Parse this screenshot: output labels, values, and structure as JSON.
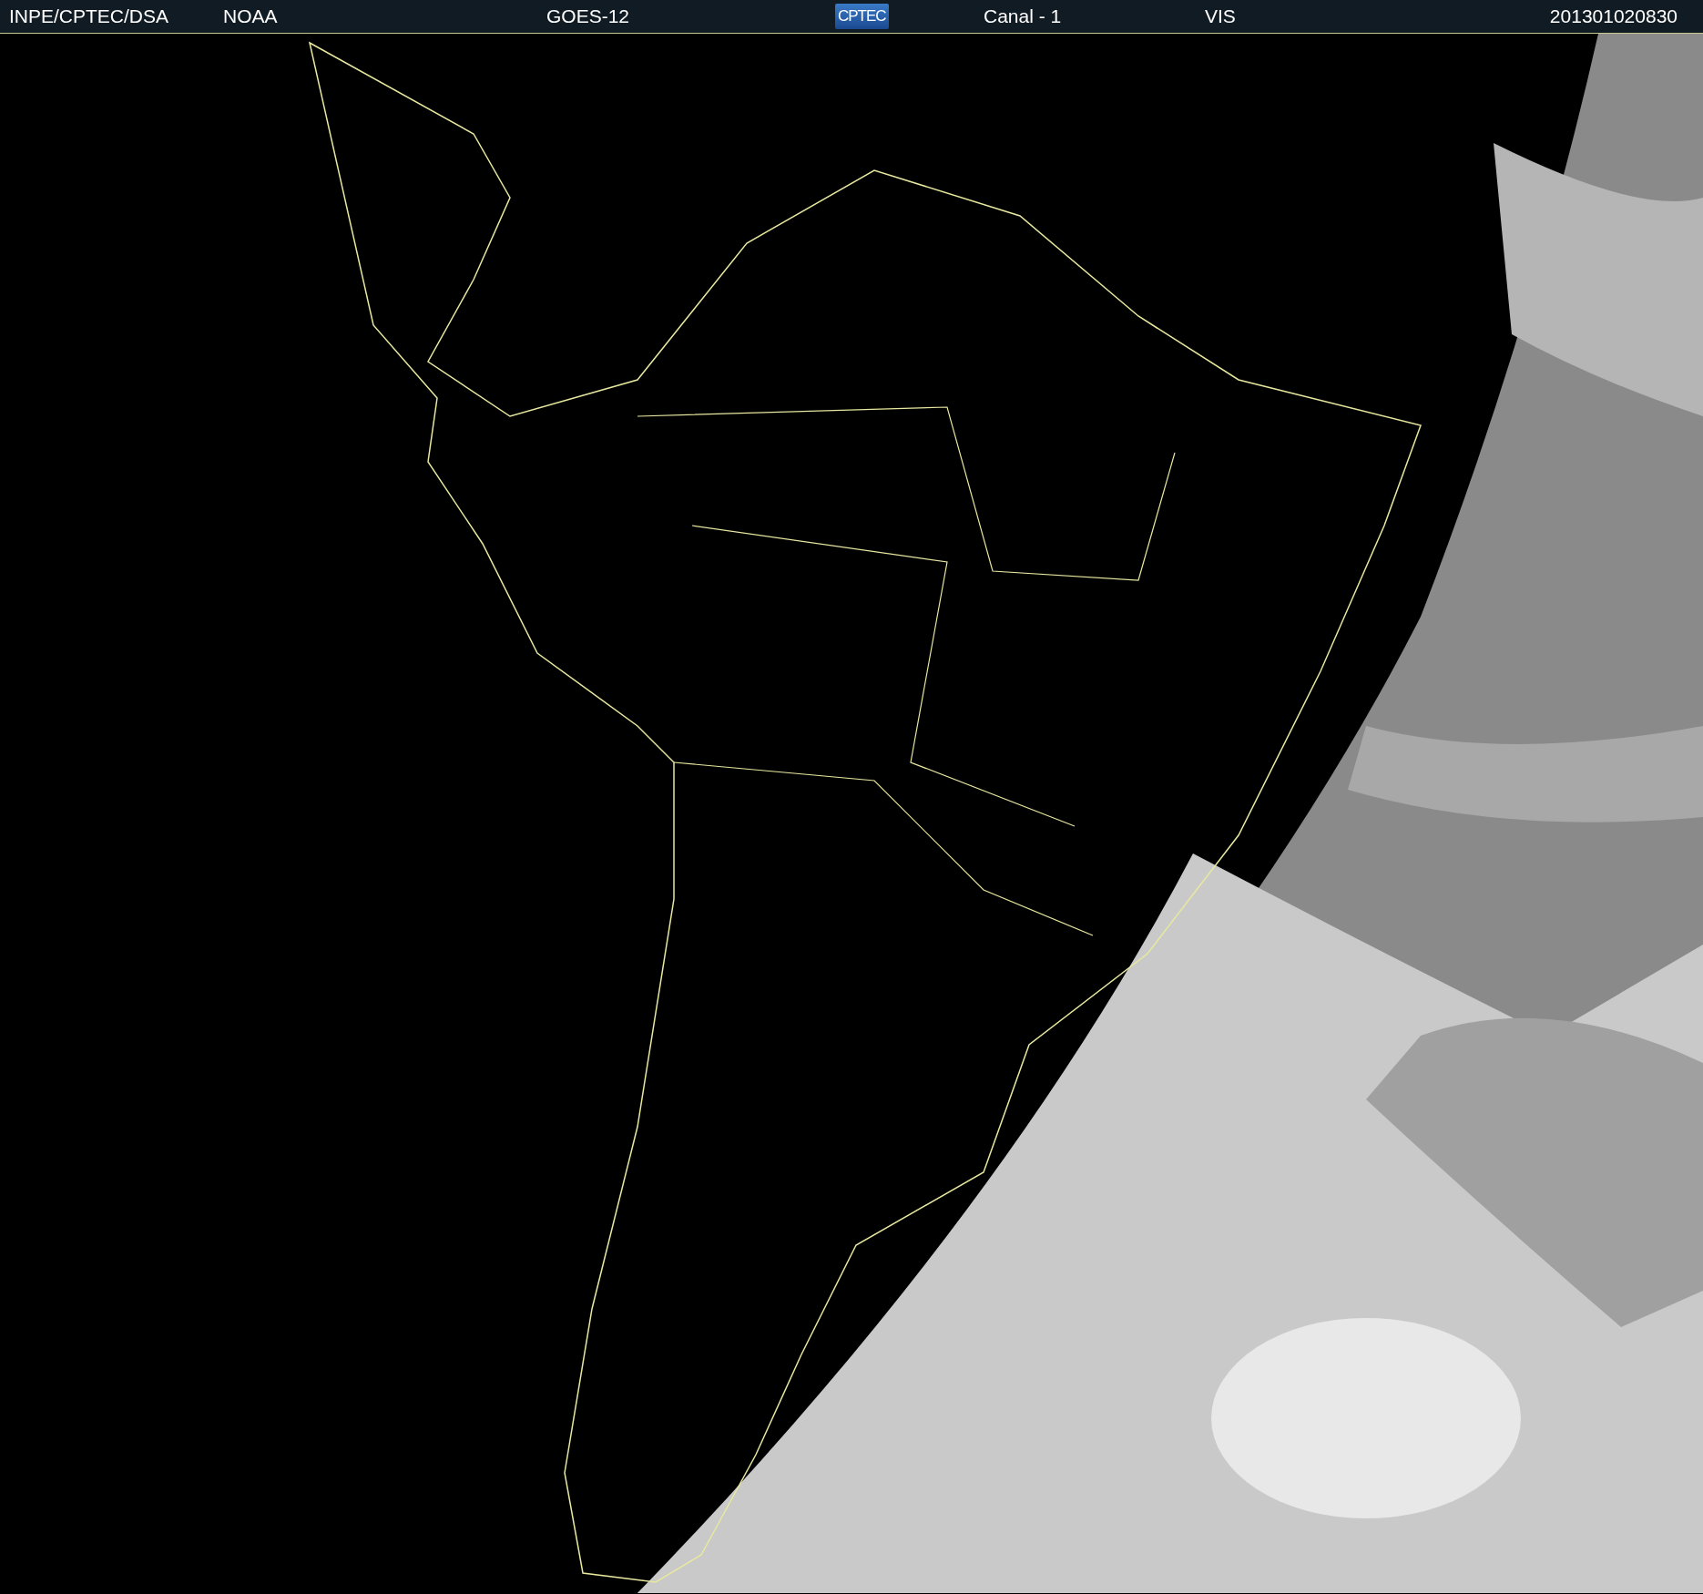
{
  "header": {
    "source": "INPE/CPTEC/DSA",
    "agency": "NOAA",
    "satellite": "GOES-12",
    "logo": "CPTEC",
    "channel": "Canal - 1",
    "band": "VIS",
    "timestamp": "201301020830"
  }
}
